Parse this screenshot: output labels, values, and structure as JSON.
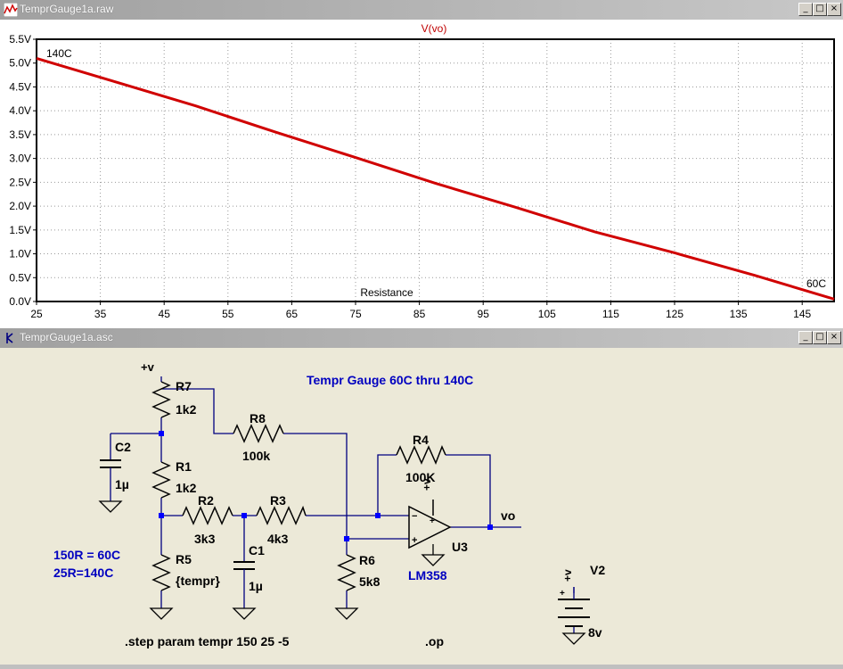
{
  "plot_window": {
    "title": "TemprGauge1a.raw",
    "trace_label": "V(vo)",
    "x_axis_label": "Resistance",
    "annotations": [
      "140C",
      "60C"
    ],
    "buttons": [
      "_",
      "□",
      "×"
    ],
    "colors": {
      "trace": "#d00000",
      "title_trace": "#c00000",
      "background": "#ffffff"
    }
  },
  "chart_data": {
    "type": "line",
    "title": "V(vo)",
    "xlabel": "Resistance",
    "ylabel": "",
    "x_ticks": [
      "25",
      "35",
      "45",
      "55",
      "65",
      "75",
      "85",
      "95",
      "105",
      "115",
      "125",
      "135",
      "145"
    ],
    "y_ticks": [
      "0.0V",
      "0.5V",
      "1.0V",
      "1.5V",
      "2.0V",
      "2.5V",
      "3.0V",
      "3.5V",
      "4.0V",
      "4.5V",
      "5.0V",
      "5.5V"
    ],
    "xlim": [
      25,
      150
    ],
    "ylim": [
      0,
      5.5
    ],
    "grid": true,
    "series": [
      {
        "x": [
          25,
          37.5,
          50,
          62.5,
          75,
          87.5,
          100,
          112.5,
          125,
          137.5,
          150
        ],
        "y": [
          5.1,
          4.6,
          4.1,
          3.55,
          3.02,
          2.48,
          1.98,
          1.46,
          1.02,
          0.55,
          0.05
        ]
      }
    ],
    "annotations": [
      {
        "text": "140C",
        "x": 25,
        "y": 5.1
      },
      {
        "text": "60C",
        "x": 150,
        "y": 0.05
      }
    ]
  },
  "schematic_window": {
    "title": "TemprGauge1a.asc",
    "buttons": [
      "_",
      "□",
      "×"
    ],
    "heading": "Tempr Gauge 60C thru 140C",
    "notes": [
      "150R = 60C",
      "25R=140C"
    ],
    "directives": [
      ".step param tempr 150 25  -5",
      ".op"
    ],
    "supply_labels": [
      "+v",
      "+v",
      "+v"
    ],
    "output_label": "vo",
    "components": [
      {
        "ref": "R7",
        "value": "1k2"
      },
      {
        "ref": "R1",
        "value": "1k2"
      },
      {
        "ref": "R5",
        "value": "{tempr}"
      },
      {
        "ref": "R2",
        "value": "3k3"
      },
      {
        "ref": "R3",
        "value": "4k3"
      },
      {
        "ref": "R8",
        "value": "100k"
      },
      {
        "ref": "R4",
        "value": "100K"
      },
      {
        "ref": "R6",
        "value": "5k8"
      },
      {
        "ref": "C1",
        "value": "1µ"
      },
      {
        "ref": "C2",
        "value": "1µ"
      },
      {
        "ref": "U3",
        "value": "LM358"
      },
      {
        "ref": "V2",
        "value": "8v"
      }
    ],
    "colors": {
      "wire": "#000080",
      "component": "#000000",
      "note_text": "#0000c0",
      "background": "#ece9d8"
    }
  }
}
